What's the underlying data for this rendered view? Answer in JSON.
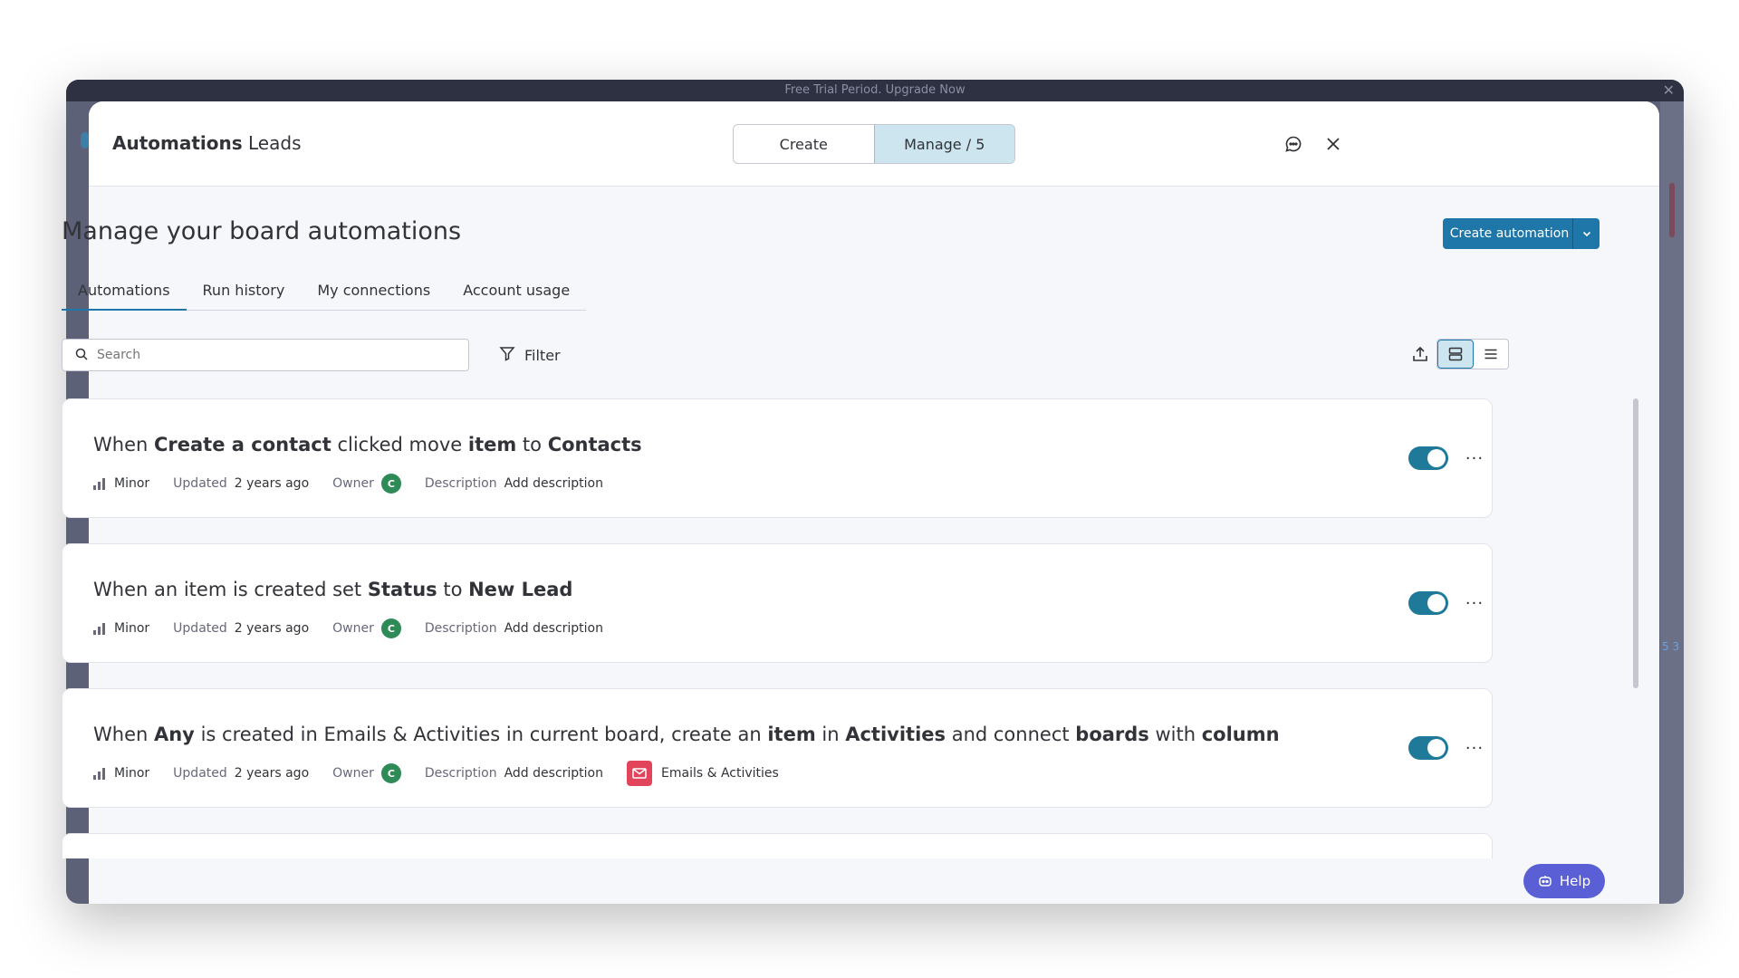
{
  "background": {
    "trial_text": "Free Trial Period. Upgrade Now",
    "side_text": "5 3"
  },
  "header": {
    "title_bold": "Automations",
    "title_rest": "Leads",
    "segments": [
      "Create",
      "Manage / 5"
    ],
    "active_segment": "Manage / 5",
    "icons": [
      "feedback-icon",
      "close-icon"
    ]
  },
  "main": {
    "title": "Manage your board automations",
    "create_button": "Create automation",
    "tabs": [
      "Automations",
      "Run history",
      "My connections",
      "Account usage"
    ],
    "active_tab": "Automations",
    "search_placeholder": "Search",
    "filter_label": "Filter",
    "view_mode": "cards"
  },
  "automations": [
    {
      "title_parts": [
        {
          "t": "When ",
          "b": false
        },
        {
          "t": "Create a contact",
          "b": true
        },
        {
          "t": " clicked move ",
          "b": false
        },
        {
          "t": "item",
          "b": true
        },
        {
          "t": " to ",
          "b": false
        },
        {
          "t": "Contacts",
          "b": true
        }
      ],
      "impact": "Minor",
      "updated_label": "Updated",
      "updated": "2 years ago",
      "owner_label": "Owner",
      "owner_initial": "C",
      "description_label": "Description",
      "description": "Add description",
      "board": "",
      "enabled": true
    },
    {
      "title_parts": [
        {
          "t": "When an item is created set ",
          "b": false
        },
        {
          "t": "Status",
          "b": true
        },
        {
          "t": " to ",
          "b": false
        },
        {
          "t": "New Lead",
          "b": true
        }
      ],
      "impact": "Minor",
      "updated_label": "Updated",
      "updated": "2 years ago",
      "owner_label": "Owner",
      "owner_initial": "C",
      "description_label": "Description",
      "description": "Add description",
      "board": "",
      "enabled": true
    },
    {
      "title_parts": [
        {
          "t": "When ",
          "b": false
        },
        {
          "t": "Any",
          "b": true
        },
        {
          "t": " is created in Emails & Activities in current board, create an ",
          "b": false
        },
        {
          "t": "item",
          "b": true
        },
        {
          "t": " in ",
          "b": false
        },
        {
          "t": "Activities",
          "b": true
        },
        {
          "t": " and connect ",
          "b": false
        },
        {
          "t": "boards",
          "b": true
        },
        {
          "t": " with ",
          "b": false
        },
        {
          "t": "column",
          "b": true
        }
      ],
      "impact": "Minor",
      "updated_label": "Updated",
      "updated": "2 years ago",
      "owner_label": "Owner",
      "owner_initial": "C",
      "description_label": "Description",
      "description": "Add description",
      "board": "Emails & Activities",
      "enabled": true
    }
  ],
  "help_label": "Help",
  "colors": {
    "primary": "#1f76a8",
    "toggle_on": "#1f7a9a",
    "owner_avatar": "#2e8b57",
    "board_icon": "#e2445c",
    "help": "#5b5fd6"
  }
}
